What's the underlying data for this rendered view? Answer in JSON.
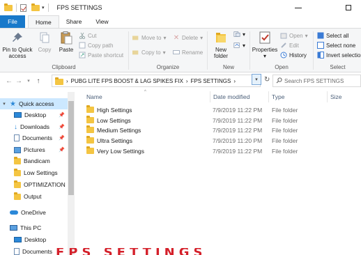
{
  "window": {
    "title": "FPS SETTINGS",
    "minimize_glyph": "—",
    "maximize_glyph": "☐"
  },
  "tabs": [
    {
      "label": "File"
    },
    {
      "label": "Home"
    },
    {
      "label": "Share"
    },
    {
      "label": "View"
    }
  ],
  "ribbon": {
    "clipboard": {
      "label": "Clipboard",
      "pin": "Pin to Quick access",
      "copy": "Copy",
      "paste": "Paste",
      "cut": "Cut",
      "copy_path": "Copy path",
      "paste_shortcut": "Paste shortcut"
    },
    "organize": {
      "label": "Organize",
      "move_to": "Move to",
      "copy_to": "Copy to",
      "delete": "Delete",
      "rename": "Rename"
    },
    "new": {
      "label": "New",
      "new_folder": "New folder"
    },
    "open": {
      "label": "Open",
      "properties": "Properties",
      "open": "Open",
      "edit": "Edit",
      "history": "History"
    },
    "select": {
      "label": "Select",
      "select_all": "Select all",
      "select_none": "Select none",
      "invert_selection": "Invert selection"
    }
  },
  "address": {
    "crumbs": [
      "PUBG LITE FPS BOOST & LAG SPIKES FIX",
      "FPS SETTINGS"
    ],
    "separator": "›",
    "search_placeholder": "Search FPS SETTINGS"
  },
  "nav": {
    "quick_access": "Quick access",
    "items": [
      {
        "label": "Desktop",
        "icon": "desktop-icon",
        "pinned": true
      },
      {
        "label": "Downloads",
        "icon": "download-icon",
        "pinned": true
      },
      {
        "label": "Documents",
        "icon": "documents-icon",
        "pinned": true
      },
      {
        "label": "Pictures",
        "icon": "pictures-icon",
        "pinned": true
      },
      {
        "label": "Bandicam",
        "icon": "folder-icon",
        "pinned": false
      },
      {
        "label": "Low Settings",
        "icon": "folder-icon",
        "pinned": false
      },
      {
        "label": "OPTIMIZATION",
        "icon": "folder-icon",
        "pinned": false
      },
      {
        "label": "Output",
        "icon": "folder-icon",
        "pinned": false
      }
    ],
    "onedrive": "OneDrive",
    "this_pc": "This PC",
    "pc_items": [
      {
        "label": "Desktop"
      },
      {
        "label": "Documents"
      }
    ]
  },
  "columns": {
    "name": "Name",
    "date": "Date modified",
    "type": "Type",
    "size": "Size"
  },
  "files": [
    {
      "name": "High Settings",
      "date": "7/9/2019 11:22 PM",
      "type": "File folder"
    },
    {
      "name": "Low Settings",
      "date": "7/9/2019 11:22 PM",
      "type": "File folder"
    },
    {
      "name": "Medium Settings",
      "date": "7/9/2019 11:22 PM",
      "type": "File folder"
    },
    {
      "name": "Ultra Settings",
      "date": "7/9/2019 11:20 PM",
      "type": "File folder"
    },
    {
      "name": "Very Low Settings",
      "date": "7/9/2019 11:22 PM",
      "type": "File folder"
    }
  ],
  "overlay_text": "FPS SETTINGS",
  "colors": {
    "accent": "#1979ca",
    "selection": "#cce8ff",
    "folder": "#f4c542",
    "overlay": "#d4202a"
  }
}
